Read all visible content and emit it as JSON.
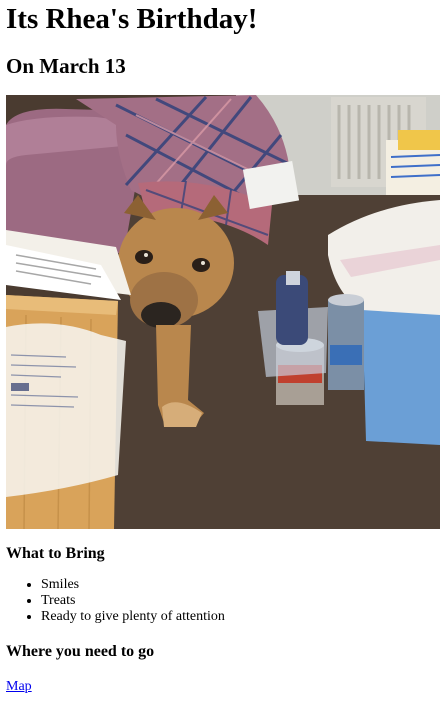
{
  "page": {
    "title": "Its Rhea's Birthday!",
    "subtitle": "On March 13"
  },
  "photo": {
    "alt": "Dog peeking out under a pile of plaid clothing next to a desk"
  },
  "bring": {
    "heading": "What to Bring",
    "items": [
      "Smiles",
      "Treats",
      "Ready to give plenty of attention"
    ]
  },
  "where": {
    "heading": "Where you need to go",
    "link_label": "Map"
  },
  "colors": {
    "link": "#0000ee",
    "carpet": "#4a3b30",
    "desk": "#d9a35a",
    "bin": "#6b9fd6"
  }
}
